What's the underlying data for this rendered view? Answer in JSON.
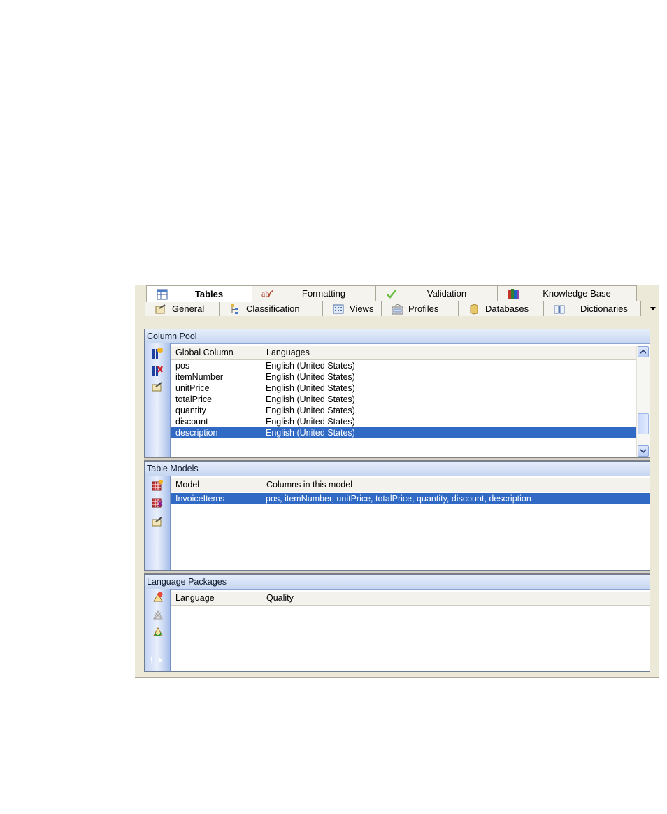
{
  "tabs_row1": [
    {
      "label": "Tables",
      "icon": "table-icon",
      "active": true
    },
    {
      "label": "Formatting",
      "icon": "spelling-icon"
    },
    {
      "label": "Validation",
      "icon": "checkmark-icon"
    },
    {
      "label": "Knowledge Base",
      "icon": "books-icon"
    }
  ],
  "tabs_row2": [
    {
      "label": "General",
      "icon": "properties-icon"
    },
    {
      "label": "Classification",
      "icon": "tree-icon"
    },
    {
      "label": "Views",
      "icon": "grid-view-icon"
    },
    {
      "label": "Profiles",
      "icon": "profile-icon"
    },
    {
      "label": "Databases",
      "icon": "database-icon"
    },
    {
      "label": "Dictionaries",
      "icon": "book-icon"
    }
  ],
  "column_pool": {
    "title": "Column Pool",
    "headers": [
      "Global Column",
      "Languages"
    ],
    "rows": [
      {
        "column": "pos",
        "languages": "English (United States)"
      },
      {
        "column": "itemNumber",
        "languages": "English (United States)"
      },
      {
        "column": "unitPrice",
        "languages": "English (United States)"
      },
      {
        "column": "totalPrice",
        "languages": "English (United States)"
      },
      {
        "column": "quantity",
        "languages": "English (United States)"
      },
      {
        "column": "discount",
        "languages": "English (United States)"
      },
      {
        "column": "description",
        "languages": "English (United States)",
        "selected": true
      }
    ],
    "toolbar_icons": [
      "add-column-icon",
      "delete-column-icon",
      "edit-column-icon"
    ]
  },
  "table_models": {
    "title": "Table Models",
    "headers": [
      "Model",
      "Columns in this model"
    ],
    "rows": [
      {
        "model": "InvoiceItems",
        "columns": "pos, itemNumber, unitPrice, totalPrice, quantity, discount, description",
        "selected": true
      }
    ],
    "toolbar_icons": [
      "add-model-icon",
      "delete-model-icon",
      "edit-model-icon"
    ]
  },
  "language_packages": {
    "title": "Language Packages",
    "headers": [
      "Language",
      "Quality"
    ],
    "rows": [],
    "toolbar_icons": [
      "add-language-icon",
      "remove-language-icon",
      "refresh-language-icon",
      "more-options-icon"
    ]
  },
  "colors": {
    "selection": "#316ac5",
    "panel_header": "#c6d6f1",
    "toolbar_bar": "#c3d4f4",
    "window_bg": "#ece9d8"
  }
}
